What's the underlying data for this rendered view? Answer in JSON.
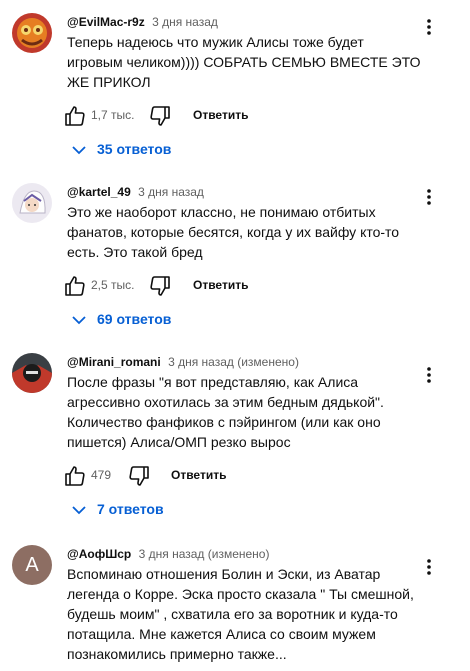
{
  "ui": {
    "reply_label": "Ответить",
    "accent_color": "#065fd4",
    "more_icon": "three-dots-vertical-icon",
    "like_icon": "thumb-up-icon",
    "dislike_icon": "thumb-down-icon",
    "expand_icon": "chevron-down-icon"
  },
  "comments": [
    {
      "author": "@EvilMac-r9z",
      "time": "3 дня назад",
      "text": "Теперь надеюсь что мужик Алисы тоже будет игровым челиком)))) СОБРАТЬ СЕМЬЮ ВМЕСТЕ ЭТО ЖЕ ПРИКОЛ",
      "likes": "1,7 тыс.",
      "replies_label": "35 ответов"
    },
    {
      "author": "@kartel_49",
      "time": "3 дня назад",
      "text": "Это же наоборот классно, не понимаю отбитых фанатов, которые бесятся, когда у их вайфу кто-то есть. Это такой бред",
      "likes": "2,5 тыс.",
      "replies_label": "69 ответов"
    },
    {
      "author": "@Mirani_romani",
      "time": "3 дня назад (изменено)",
      "text": "После фразы \"я вот представляю, как Алиса агрессивно охотилась за этим бедным дядькой\". Количество фанфиков с пэйрингом (или как оно пишется) Алиса/ОМП резко вырос",
      "likes": "479",
      "replies_label": "7 ответов"
    },
    {
      "author": "@АофШср",
      "time": "3 дня назад (изменено)",
      "avatar_letter": "А",
      "text": "Вспоминаю отношения Болин и Эски, из Аватар легенда о Корре. Эска просто сказала \" Ты смешной, будешь моим\" , схватила его за воротник и куда-то потащила. Мне кажется Алиса со своим мужем познакомились примерно  также..."
    }
  ]
}
